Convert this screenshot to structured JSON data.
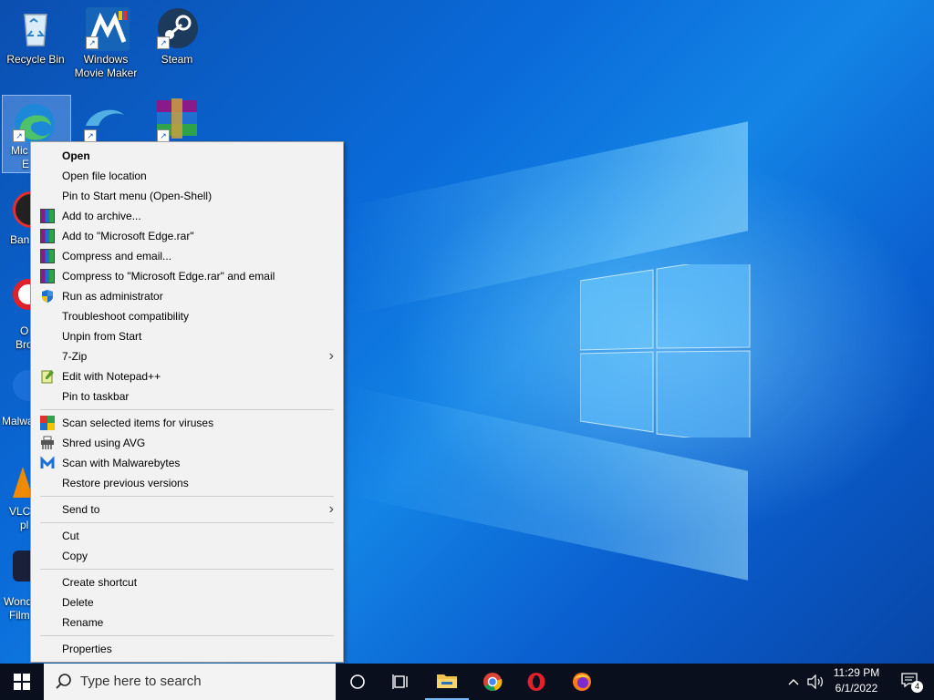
{
  "desktop_icons": [
    {
      "label": "Recycle Bin",
      "icon": "recycle-bin-icon"
    },
    {
      "label": "Windows Movie Maker",
      "icon": "movie-maker-icon"
    },
    {
      "label": "Steam",
      "icon": "steam-icon"
    }
  ],
  "partial_icon_labels": {
    "edge_top": "Mic",
    "edge_bottom": "E",
    "bandicam": "Ban",
    "opera_top": "O",
    "opera_bottom": "Bro",
    "malware": "Malwa",
    "vlc_top": "VLC",
    "vlc_bottom": "pl",
    "wonder_top": "Wond",
    "wonder_bottom": "Film"
  },
  "context_menu": {
    "items": [
      {
        "label": "Open",
        "icon": "",
        "bold": true
      },
      {
        "label": "Open file location",
        "icon": ""
      },
      {
        "label": "Pin to Start menu (Open-Shell)",
        "icon": ""
      },
      {
        "label": "Add to archive...",
        "icon": "winrar-icon"
      },
      {
        "label": "Add to \"Microsoft Edge.rar\"",
        "icon": "winrar-icon"
      },
      {
        "label": "Compress and email...",
        "icon": "winrar-icon"
      },
      {
        "label": "Compress to \"Microsoft Edge.rar\" and email",
        "icon": "winrar-icon"
      },
      {
        "label": "Run as administrator",
        "icon": "uac-shield-icon"
      },
      {
        "label": "Troubleshoot compatibility",
        "icon": ""
      },
      {
        "label": "Unpin from Start",
        "icon": ""
      },
      {
        "label": "7-Zip",
        "icon": "",
        "submenu": true
      },
      {
        "label": "Edit with Notepad++",
        "icon": "notepad-plus-plus-icon"
      },
      {
        "label": "Pin to taskbar",
        "icon": ""
      },
      {
        "label": "Scan selected items for viruses",
        "icon": "avg-icon"
      },
      {
        "label": "Shred using AVG",
        "icon": "shredder-icon"
      },
      {
        "label": "Scan with Malwarebytes",
        "icon": "malwarebytes-icon"
      },
      {
        "label": "Restore previous versions",
        "icon": ""
      },
      {
        "label": "Send to",
        "icon": "",
        "submenu": true
      },
      {
        "label": "Cut",
        "icon": ""
      },
      {
        "label": "Copy",
        "icon": ""
      },
      {
        "label": "Create shortcut",
        "icon": ""
      },
      {
        "label": "Delete",
        "icon": ""
      },
      {
        "label": "Rename",
        "icon": ""
      },
      {
        "label": "Properties",
        "icon": ""
      }
    ]
  },
  "taskbar": {
    "search_placeholder": "Type here to search",
    "time": "11:29 PM",
    "date": "6/1/2022",
    "notification_count": "4",
    "pinned": [
      "start-icon",
      "cortana-icon",
      "task-view-icon",
      "file-explorer-icon",
      "chrome-icon",
      "opera-icon",
      "firefox-icon"
    ]
  },
  "colors": {
    "taskbar": "#0a0f1e",
    "menu_bg": "#f2f2f2",
    "desktop_blue": "#0a6ad8"
  }
}
